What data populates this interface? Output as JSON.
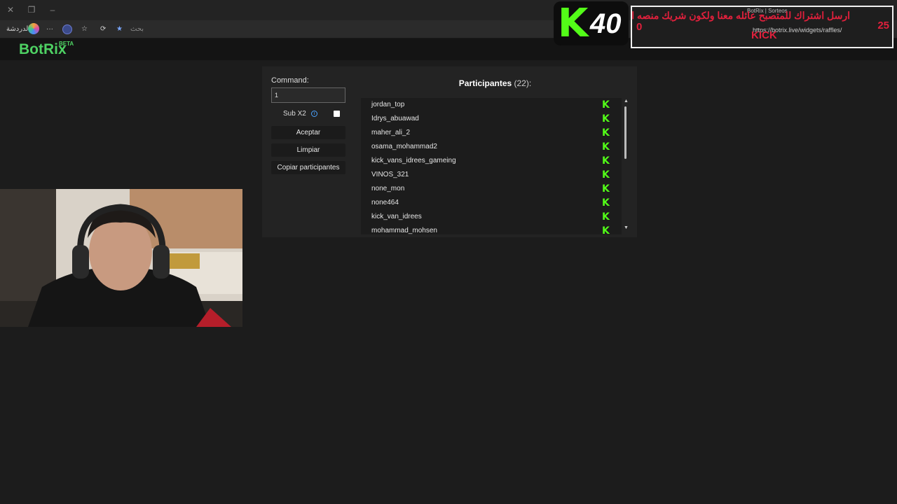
{
  "browser": {
    "sidebar_label": "الدردشة",
    "address_placeholder": "بحث"
  },
  "app": {
    "logo": "BotRix",
    "logo_badge": "BETA"
  },
  "raffle": {
    "command_label": "Command:",
    "command_value": "1",
    "sub_label": "Sub X2",
    "sub_checked": false,
    "accept_label": "Aceptar",
    "clear_label": "Limpiar",
    "copy_label": "Copiar participantes",
    "participants_title": "Participantes",
    "participants_count": "(22):",
    "participants": [
      "jordan_top",
      "Idrys_abuawad",
      "maher_ali_2",
      "osama_mohammad2",
      "kick_vans_idrees_gameing",
      "VINOS_321",
      "none_mon",
      "none464",
      "kick_van_idrees",
      "mohammad_mohsen"
    ],
    "platform_icon": "kick-icon",
    "accent_color": "#53fc18"
  },
  "overlay": {
    "kick_letter": "K",
    "kick_count": "40",
    "tab_title": "BotRix | Sorteos",
    "url": "https://botrix.live/widgets/raffles/",
    "message": "ارسل اشتراك للمتصبح عائله معنا ولكون شريك منصه ال",
    "kick_word": "KICK",
    "left_number": "0",
    "right_number": "25",
    "alert_color": "#e0203c"
  }
}
